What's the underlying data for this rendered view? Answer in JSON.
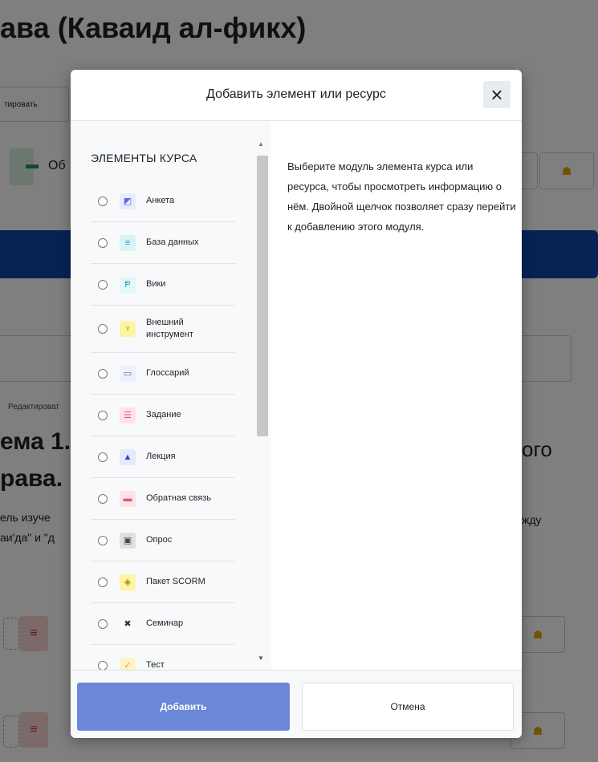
{
  "background": {
    "title_top": "|",
    "title": "ава (Каваид ал-фикх)",
    "edit_button": "тировать",
    "forum_label": "Об",
    "edit_label": "Редактироват",
    "heading_line1": "ема 1.",
    "heading_line2": "рава.",
    "heading_right": "ого",
    "text_line1": "ель изуче",
    "text_line2": "аи'да\" и \"д",
    "text_right": "жду"
  },
  "modal": {
    "title": "Добавить элемент или ресурс",
    "close_label": "×",
    "section_label": "ЭЛЕМЕНТЫ КУРСА",
    "items": [
      {
        "label": "Анкета",
        "icon": "survey-icon",
        "color": "#5b6ee1",
        "bg": "#e8ebfb"
      },
      {
        "label": "База данных",
        "icon": "database-icon",
        "color": "#16a2b8",
        "bg": "#d9f3f6"
      },
      {
        "label": "Вики",
        "icon": "wiki-icon",
        "color": "#17a2b8",
        "bg": "#e3f6f8"
      },
      {
        "label": "Внешний инструмент",
        "icon": "external-tool-icon",
        "color": "#a88a00",
        "bg": "#fff3a6"
      },
      {
        "label": "Глоссарий",
        "icon": "glossary-icon",
        "color": "#5b6ee1",
        "bg": "#eef0fb"
      },
      {
        "label": "Задание",
        "icon": "assignment-icon",
        "color": "#e0556d",
        "bg": "#fde2e6"
      },
      {
        "label": "Лекция",
        "icon": "lesson-icon",
        "color": "#2146c9",
        "bg": "#e4eafb"
      },
      {
        "label": "Обратная связь",
        "icon": "feedback-icon",
        "color": "#e0556d",
        "bg": "#fde2e6"
      },
      {
        "label": "Опрос",
        "icon": "choice-icon",
        "color": "#444444",
        "bg": "#e0e0e0"
      },
      {
        "label": "Пакет SCORM",
        "icon": "scorm-icon",
        "color": "#a88a00",
        "bg": "#fff3a6"
      },
      {
        "label": "Семинар",
        "icon": "workshop-icon",
        "color": "#333333",
        "bg": "transparent"
      },
      {
        "label": "Тест",
        "icon": "quiz-icon",
        "color": "#e0a800",
        "bg": "#fff4c8"
      }
    ],
    "info_text": "Выберите модуль элемента курса или ресурса, чтобы просмотреть информацию о нём. Двойной щелчок позволяет сразу перейти к добавлению этого модуля.",
    "add_label": "Добавить",
    "cancel_label": "Отмена"
  }
}
